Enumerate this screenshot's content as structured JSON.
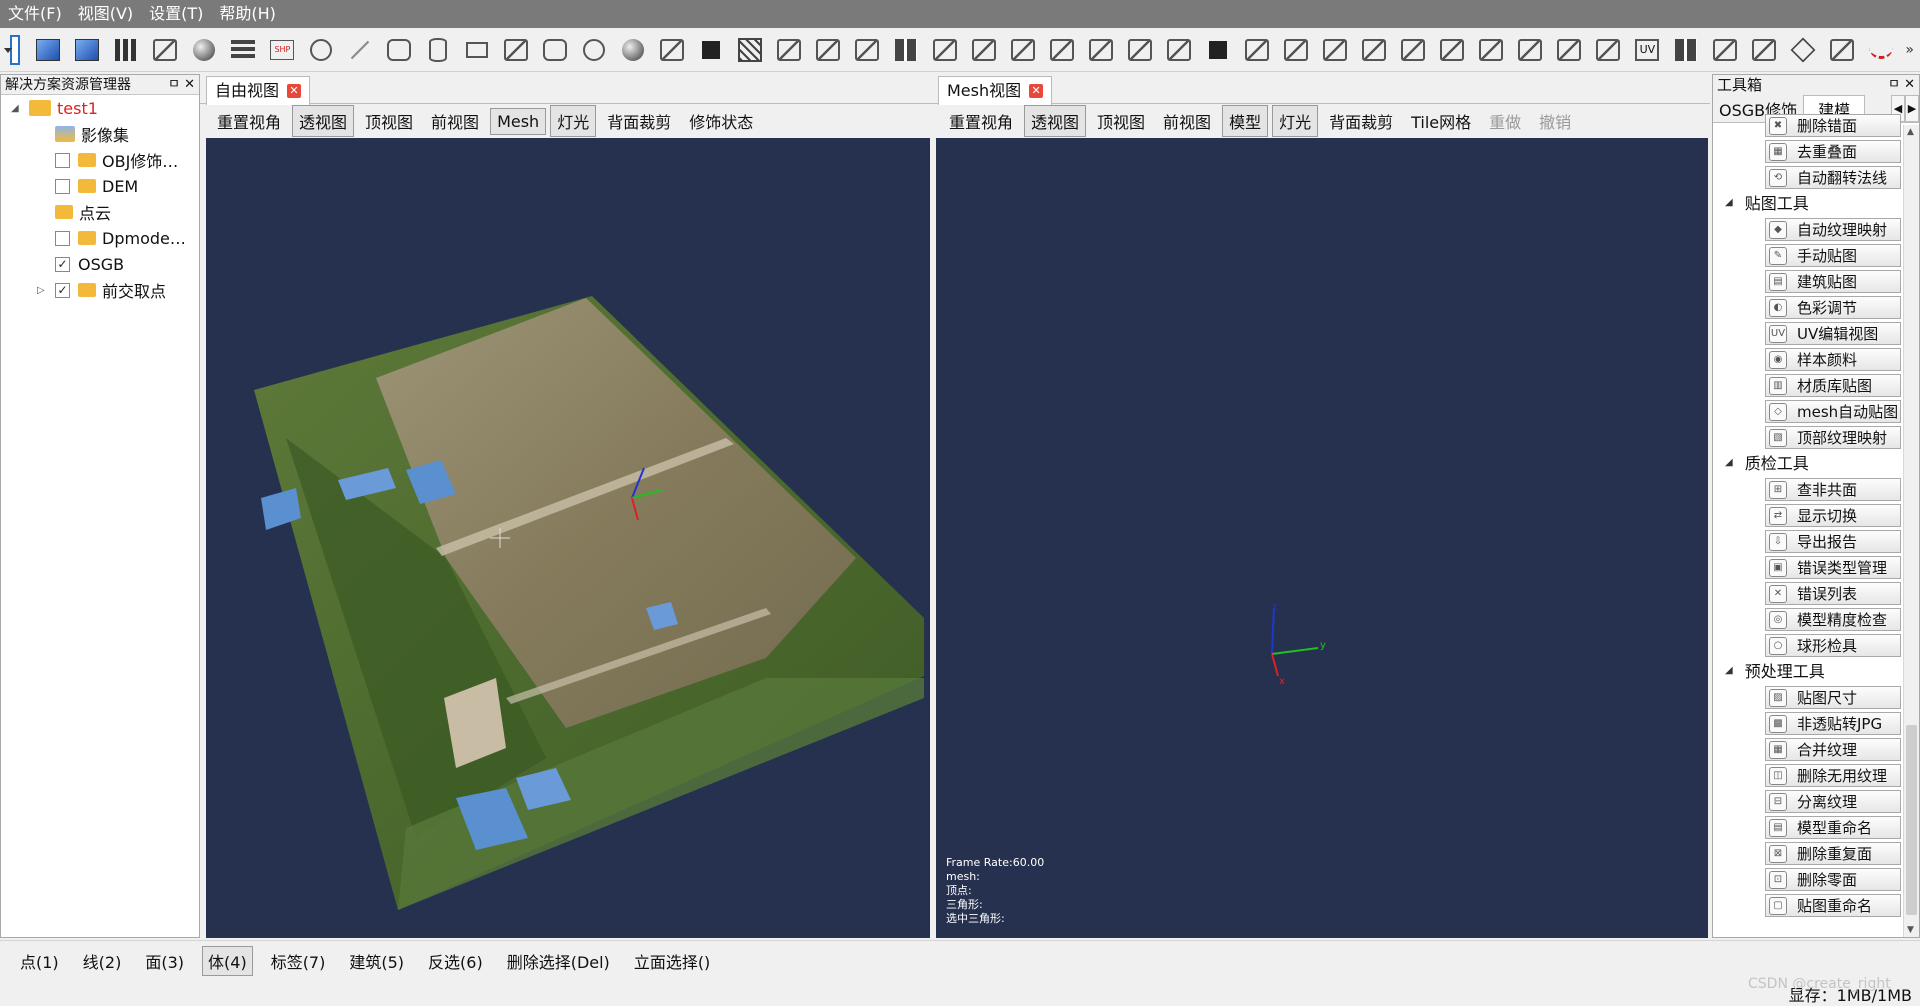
{
  "menu": [
    "文件(F)",
    "视图(V)",
    "设置(T)",
    "帮助(H)"
  ],
  "toolbar": {
    "combo_value": "",
    "icons": [
      "box-view-icon",
      "solid-box-icon",
      "bars-icon",
      "select-tool-icon",
      "sphere-tool-icon",
      "layers-icon",
      "shp-import-icon",
      "circle-arrow-icon",
      "line-tool-icon",
      "pentagon-icon",
      "cylinder-icon",
      "rectangle-icon",
      "plane-icon",
      "hexagon-icon",
      "circle-icon",
      "shaded-sphere-icon",
      "triangle-cut-icon",
      "black-square-icon",
      "hatch-icon",
      "fit-view-icon",
      "scatter-icon",
      "clip-icon",
      "grid-icon",
      "point-edit-icon",
      "move-points-icon",
      "transform-icon",
      "link-icon",
      "pin-icon",
      "pointer-move-icon",
      "rotate-icon",
      "scale-icon",
      "mirror-icon",
      "axis-icon",
      "copy-icon",
      "fill-icon",
      "paint-icon",
      "export-icon",
      "camera-icon",
      "build-icon",
      "measure-icon",
      "texture-icon",
      "uv-icon",
      "grid-icon-2",
      "split-icon",
      "monitor-icon",
      "cube-icon",
      "screen-icon",
      "curve-icon"
    ]
  },
  "left_panel": {
    "title": "解决方案资源管理器",
    "controls": "ㅁ ✕",
    "root": "test1",
    "items": [
      {
        "label": "影像集",
        "checkbox": null,
        "expander": false,
        "icon": "image-set-icon"
      },
      {
        "label": "OBJ修饰…",
        "checkbox": false,
        "expander": false,
        "icon": "mesh-folder-icon"
      },
      {
        "label": "DEM",
        "checkbox": false,
        "expander": false,
        "icon": "dem-folder-icon"
      },
      {
        "label": "点云",
        "checkbox": null,
        "expander": false,
        "icon": "point-cloud-folder-icon"
      },
      {
        "label": "Dpmode…",
        "checkbox": false,
        "expander": false,
        "icon": "folder-icon"
      },
      {
        "label": "OSGB",
        "checkbox": true,
        "expander": false,
        "icon": null
      },
      {
        "label": "前交取点",
        "checkbox": true,
        "expander": true,
        "icon": "dem-folder-icon"
      }
    ]
  },
  "free_view": {
    "tab": "自由视图",
    "buttons": [
      {
        "label": "重置视角",
        "on": false,
        "disabled": false
      },
      {
        "label": "透视图",
        "on": true,
        "disabled": false
      },
      {
        "label": "顶视图",
        "on": false,
        "disabled": false
      },
      {
        "label": "前视图",
        "on": false,
        "disabled": false
      },
      {
        "label": "Mesh",
        "on": true,
        "disabled": false
      },
      {
        "label": "灯光",
        "on": true,
        "disabled": false
      },
      {
        "label": "背面裁剪",
        "on": false,
        "disabled": false
      },
      {
        "label": "修饰状态",
        "on": false,
        "disabled": false
      }
    ]
  },
  "mesh_view": {
    "tab": "Mesh视图",
    "buttons": [
      {
        "label": "重置视角",
        "on": false,
        "disabled": false
      },
      {
        "label": "透视图",
        "on": true,
        "disabled": false
      },
      {
        "label": "顶视图",
        "on": false,
        "disabled": false
      },
      {
        "label": "前视图",
        "on": false,
        "disabled": false
      },
      {
        "label": "模型",
        "on": true,
        "disabled": false
      },
      {
        "label": "灯光",
        "on": true,
        "disabled": false
      },
      {
        "label": "背面裁剪",
        "on": false,
        "disabled": false
      },
      {
        "label": "Tile网格",
        "on": false,
        "disabled": false
      },
      {
        "label": "重做",
        "on": false,
        "disabled": true
      },
      {
        "label": "撤销",
        "on": false,
        "disabled": true
      }
    ],
    "stats": {
      "frame_rate": "Frame Rate:60.00",
      "mesh": "mesh:",
      "vertices": "顶点:",
      "triangles": "三角形:",
      "selected_triangles": "选中三角形:"
    }
  },
  "axes": {
    "x": "x",
    "y": "y",
    "z": "z"
  },
  "right_panel": {
    "title": "工具箱",
    "controls": "ㅁ ✕",
    "tabs": [
      {
        "label": "OSGB修饰",
        "on": false
      },
      {
        "label": "建模",
        "on": true
      }
    ],
    "sections": [
      {
        "group": null,
        "items": [
          "删除错面",
          "去重叠面",
          "自动翻转法线"
        ]
      },
      {
        "group": "贴图工具",
        "items": [
          "自动纹理映射",
          "手动贴图",
          "建筑贴图",
          "色彩调节",
          "UV编辑视图",
          "样本颜料",
          "材质库贴图",
          "mesh自动贴图",
          "顶部纹理映射"
        ]
      },
      {
        "group": "质检工具",
        "items": [
          "查非共面",
          "显示切换",
          "导出报告",
          "错误类型管理",
          "错误列表",
          "模型精度检查",
          "球形检具"
        ]
      },
      {
        "group": "预处理工具",
        "items": [
          "贴图尺寸",
          "非透贴转JPG",
          "合并纹理",
          "删除无用纹理",
          "分离纹理",
          "模型重命名",
          "删除重复面",
          "删除零面",
          "贴图重命名"
        ]
      }
    ]
  },
  "bottom_bar": [
    {
      "label": "点(1)",
      "on": false
    },
    {
      "label": "线(2)",
      "on": false
    },
    {
      "label": "面(3)",
      "on": false
    },
    {
      "label": "体(4)",
      "on": true
    },
    {
      "label": "标签(7)",
      "on": false
    },
    {
      "label": "建筑(5)",
      "on": false
    },
    {
      "label": "反选(6)",
      "on": false
    },
    {
      "label": "删除选择(Del)",
      "on": false
    },
    {
      "label": "立面选择()",
      "on": false
    }
  ],
  "status": {
    "memory": "显存：1MB/1MB",
    "watermark": "CSDN @create_right"
  },
  "colors": {
    "viewport_bg": "#26314f",
    "accent": "#2a6fc9",
    "menu_bg": "#7a7a7a",
    "root_label": "#e02020"
  }
}
